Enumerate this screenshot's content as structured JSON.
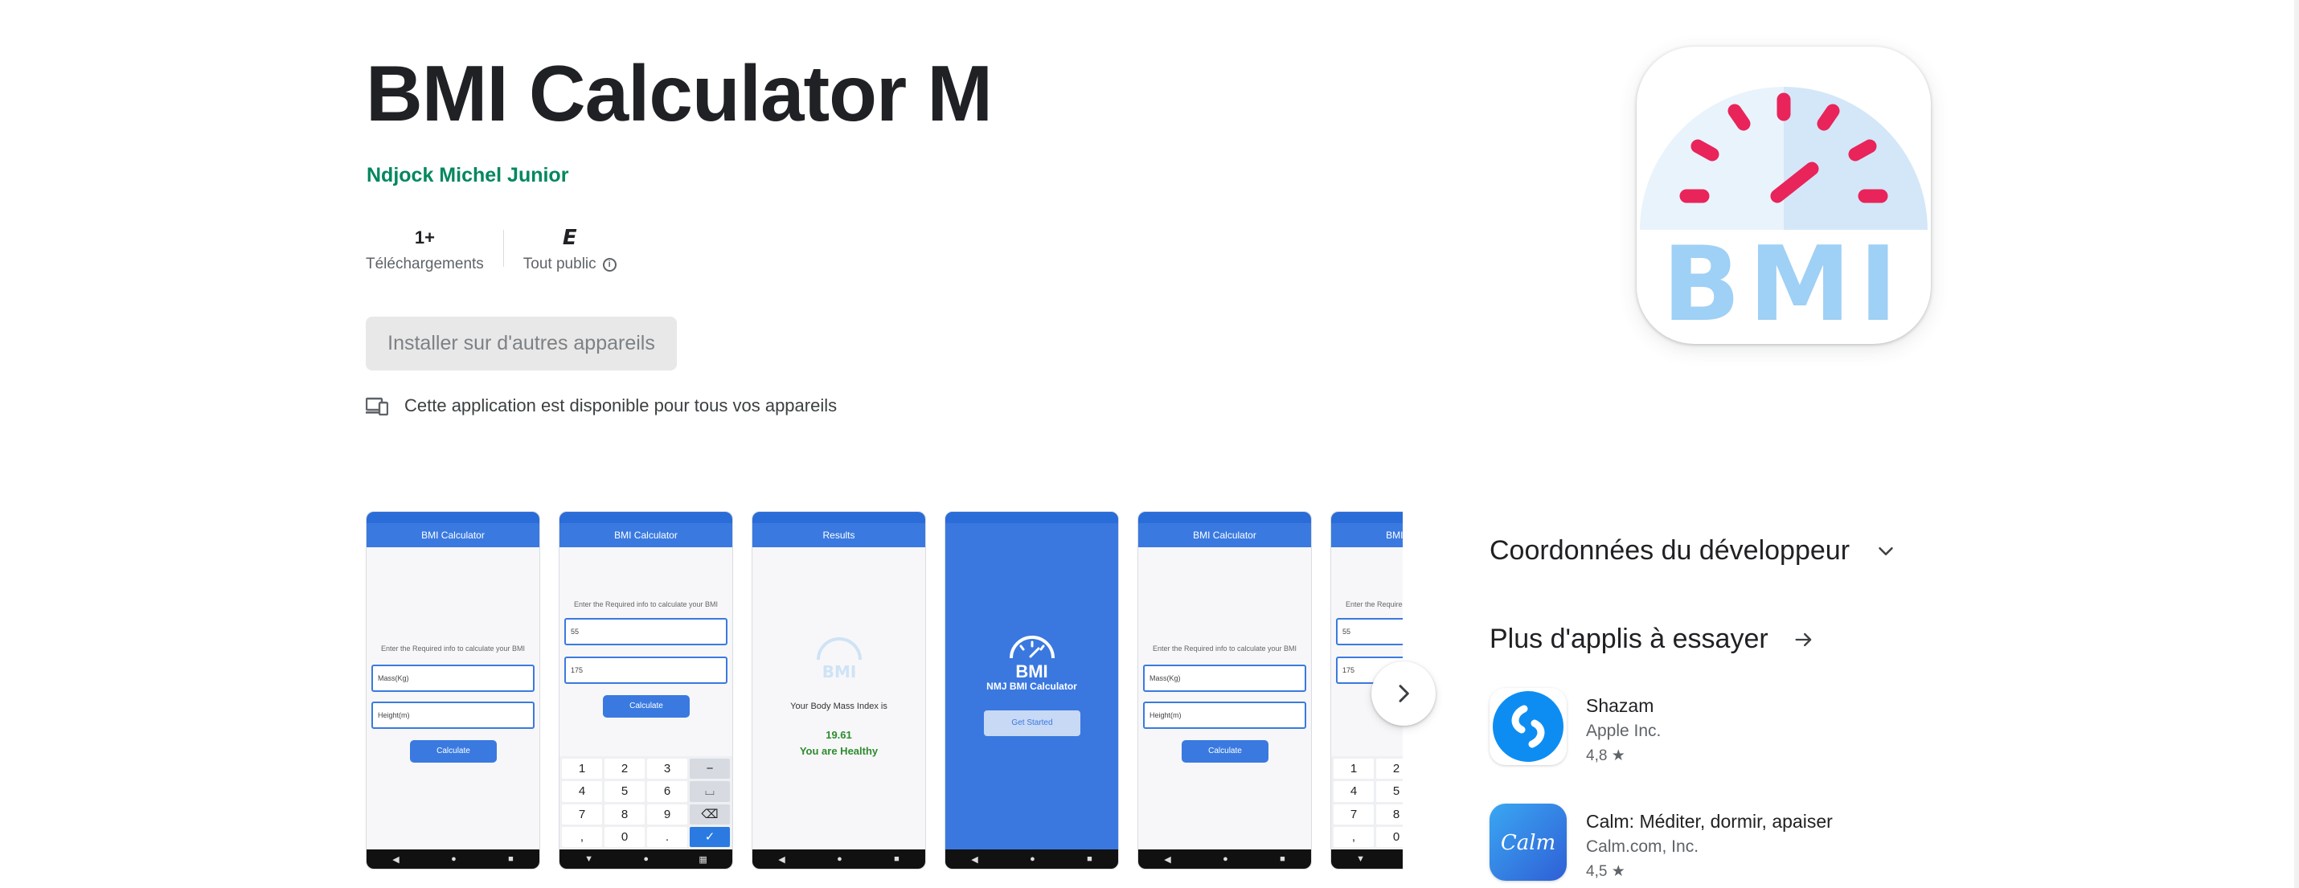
{
  "app": {
    "title": "BMI Calculator M",
    "developer": "Ndjock Michel Junior",
    "icon_text": "BMI"
  },
  "stats": {
    "downloads_value": "1+",
    "downloads_label": "Téléchargements",
    "rating_badge": "E",
    "rating_label": "Tout public",
    "info_glyph": "i"
  },
  "install_button": "Installer sur d'autres appareils",
  "availability_text": "Cette application est disponible pour tous vos appareils",
  "screenshots": {
    "calc_title": "BMI Calculator",
    "results_title": "Results",
    "prompt": "Enter the Required info to calculate your BMI",
    "mass_placeholder": "Mass(Kg)",
    "height_placeholder": "Height(m)",
    "mass_value": "55",
    "height_value": "175",
    "mass_float_label": "Mass(Kg)",
    "height_float_label": "Height(m)",
    "calculate_label": "Calculate",
    "result_heading": "Your Body Mass Index is",
    "result_value": "19.61",
    "result_status": "You are Healthy",
    "splash_bmi": "BMI",
    "splash_name": "NMJ BMI Calculator",
    "splash_button": "Get Started",
    "keys": [
      "1",
      "2",
      "3",
      "−",
      "4",
      "5",
      "6",
      "⌴",
      "7",
      "8",
      "9",
      "⌫",
      ",",
      "0",
      ".",
      "✓"
    ]
  },
  "sidebar": {
    "developer_contact": "Coordonnées du développeur",
    "more_apps": "Plus d'applis à essayer",
    "apps": [
      {
        "name": "Shazam",
        "developer": "Apple Inc.",
        "rating": "4,8 ★"
      },
      {
        "name": "Calm: Méditer, dormir, apaiser",
        "developer": "Calm.com, Inc.",
        "rating": "4,5 ★",
        "icon_text": "Calm"
      }
    ]
  },
  "icons": [
    "info-icon",
    "devices-icon",
    "chevron-right-icon",
    "chevron-down-icon",
    "arrow-right-icon",
    "shazam-icon",
    "calm-icon"
  ],
  "colors": {
    "developer_green": "#01875f",
    "app_blue": "#3a7ae0",
    "bmi_red": "#e8245a",
    "bmi_light_blue": "#9fd0f5"
  }
}
